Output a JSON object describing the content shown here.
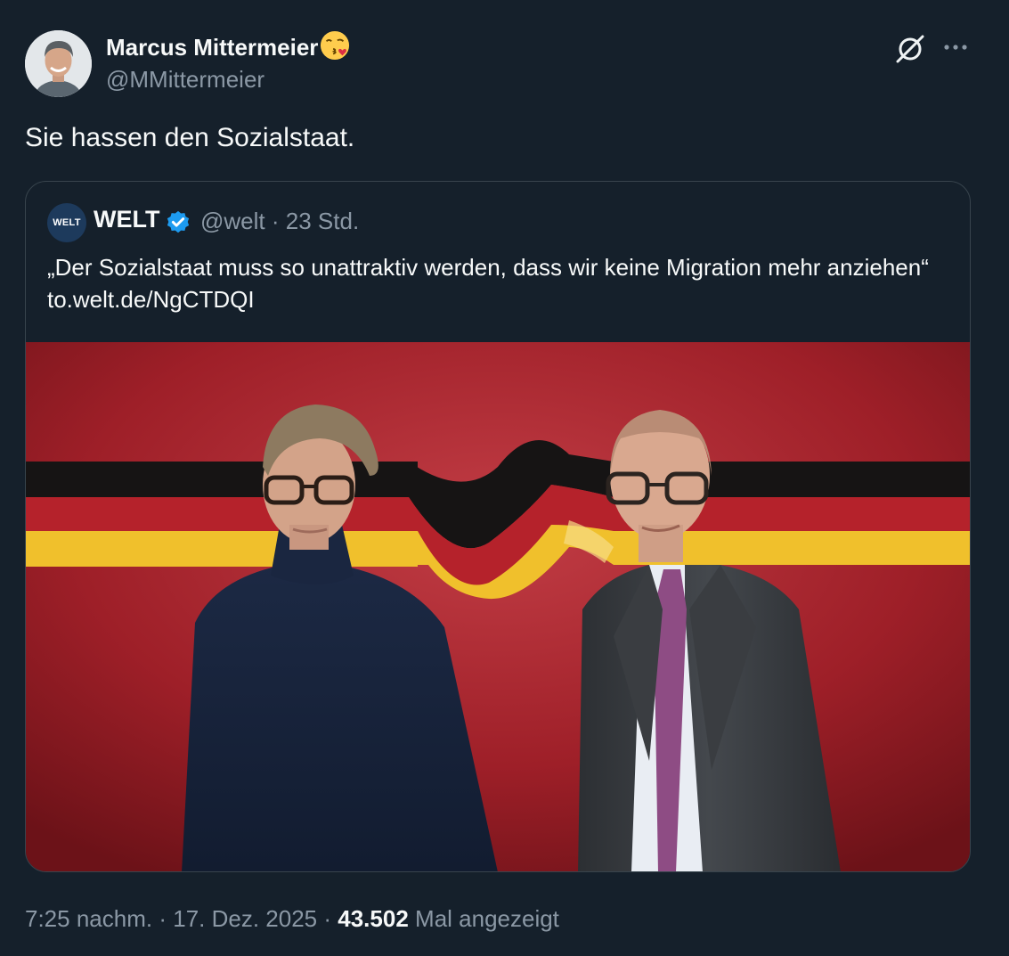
{
  "author": {
    "display_name": "Marcus Mittermeier",
    "emoji": "face-blowing-a-kiss",
    "handle": "@MMittermeier"
  },
  "actions": {
    "grok_icon": "grok-icon",
    "more_icon": "more-dots-icon"
  },
  "tweet": {
    "text": "Sie hassen den Sozialstaat."
  },
  "quote": {
    "avatar_text": "WELT",
    "name": "WELT",
    "verified_icon": "verified-badge-icon",
    "handle": "@welt",
    "separator": "·",
    "time": "23 Std.",
    "text": "„Der Sozialstaat muss so unattraktiv werden, dass wir keine Migration mehr anziehen“ to.welt.de/NgCTDQI",
    "image": "photo-two-men-german-flag"
  },
  "footer": {
    "time": "7:25 nachm.",
    "sep1": "·",
    "date": "17. Dez. 2025",
    "sep2": "·",
    "views_count": "43.502",
    "views_label": "Mal angezeigt"
  },
  "colors": {
    "background": "#15202b",
    "text": "#f7f9f9",
    "secondary": "#8b98a5",
    "border": "#38444d",
    "verified": "#1d9bf0"
  }
}
